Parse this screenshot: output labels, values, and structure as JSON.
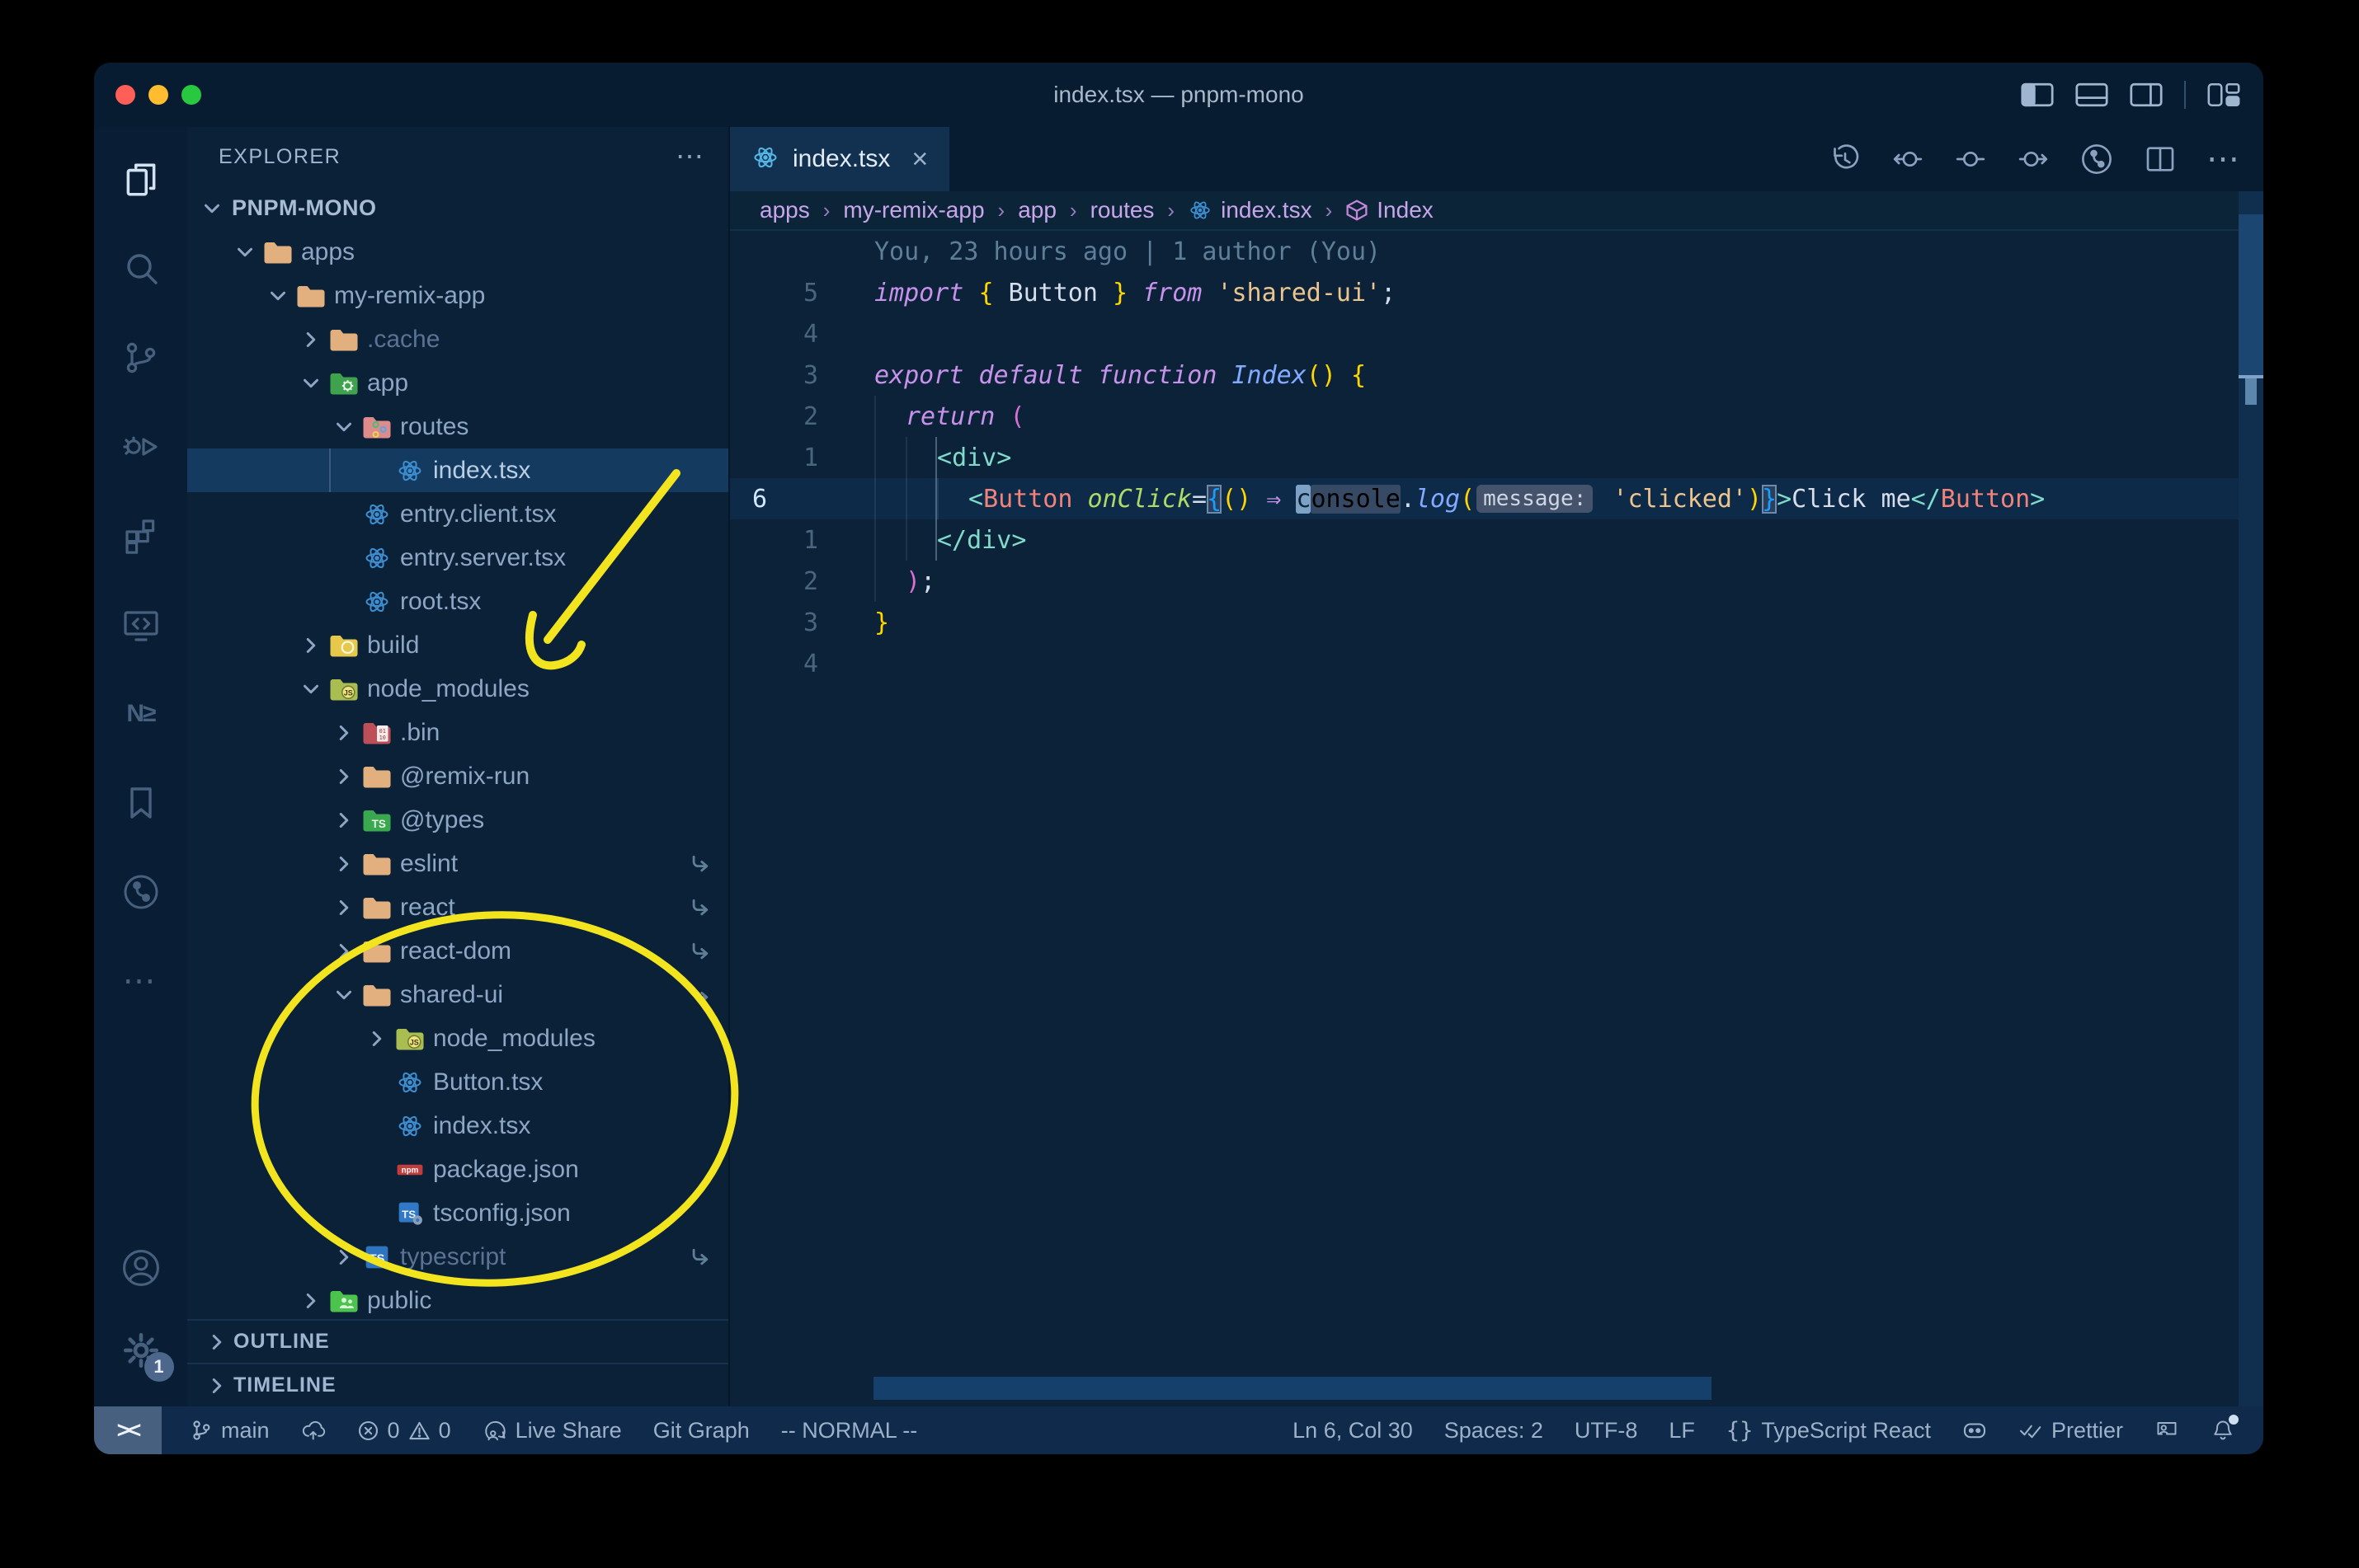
{
  "window": {
    "title": "index.tsx — pnpm-mono"
  },
  "titlebar": {
    "traffic_lights": [
      "close",
      "minimize",
      "zoom"
    ],
    "layout_icons": [
      "toggle-primary-sidebar",
      "toggle-panel",
      "toggle-secondary-sidebar",
      "customize-layout"
    ]
  },
  "activity_bar": {
    "top": [
      {
        "name": "explorer",
        "active": true
      },
      {
        "name": "search"
      },
      {
        "name": "source-control"
      },
      {
        "name": "run-and-debug"
      },
      {
        "name": "extensions"
      },
      {
        "name": "remote-explorer"
      },
      {
        "name": "nx-console",
        "text": "N≥"
      },
      {
        "name": "bookmarks"
      },
      {
        "name": "gitlens"
      },
      {
        "name": "additional-views"
      }
    ],
    "bottom": [
      {
        "name": "accounts"
      },
      {
        "name": "settings",
        "badge": "1"
      }
    ]
  },
  "sidebar": {
    "header": "EXPLORER",
    "header_menu": "⋯",
    "tree": [
      {
        "label": "PNPM-MONO",
        "level": 0,
        "chevron": "down",
        "bold": true
      },
      {
        "label": "apps",
        "level": 1,
        "chevron": "down",
        "icon": "folder-tan"
      },
      {
        "label": "my-remix-app",
        "level": 2,
        "chevron": "down",
        "icon": "folder-tan"
      },
      {
        "label": ".cache",
        "level": 3,
        "chevron": "right",
        "icon": "folder-tan",
        "dim": true
      },
      {
        "label": "app",
        "level": 3,
        "chevron": "down",
        "icon": "folder-app"
      },
      {
        "label": "routes",
        "level": 4,
        "chevron": "down",
        "icon": "folder-routes"
      },
      {
        "label": "index.tsx",
        "level": 5,
        "icon": "react",
        "selected": true,
        "guide": true
      },
      {
        "label": "entry.client.tsx",
        "level": 4,
        "icon": "react"
      },
      {
        "label": "entry.server.tsx",
        "level": 4,
        "icon": "react"
      },
      {
        "label": "root.tsx",
        "level": 4,
        "icon": "react"
      },
      {
        "label": "build",
        "level": 3,
        "chevron": "right",
        "icon": "folder-build"
      },
      {
        "label": "node_modules",
        "level": 3,
        "chevron": "down",
        "icon": "folder-js"
      },
      {
        "label": ".bin",
        "level": 4,
        "chevron": "right",
        "icon": "folder-bin"
      },
      {
        "label": "@remix-run",
        "level": 4,
        "chevron": "right",
        "icon": "folder-tan"
      },
      {
        "label": "@types",
        "level": 4,
        "chevron": "right",
        "icon": "folder-ts"
      },
      {
        "label": "eslint",
        "level": 4,
        "chevron": "right",
        "icon": "folder-tan",
        "symlink": true
      },
      {
        "label": "react",
        "level": 4,
        "chevron": "right",
        "icon": "folder-tan",
        "symlink": true
      },
      {
        "label": "react-dom",
        "level": 4,
        "chevron": "right",
        "icon": "folder-tan",
        "symlink": true
      },
      {
        "label": "shared-ui",
        "level": 4,
        "chevron": "down",
        "icon": "folder-tan",
        "symlink": true
      },
      {
        "label": "node_modules",
        "level": 5,
        "chevron": "right",
        "icon": "folder-js"
      },
      {
        "label": "Button.tsx",
        "level": 5,
        "icon": "react"
      },
      {
        "label": "index.tsx",
        "level": 5,
        "icon": "react"
      },
      {
        "label": "package.json",
        "level": 5,
        "icon": "npm"
      },
      {
        "label": "tsconfig.json",
        "level": 5,
        "icon": "ts-gear"
      },
      {
        "label": "typescript",
        "level": 4,
        "chevron": "right",
        "icon": "folder-typescript",
        "dim": true,
        "symlink": true
      },
      {
        "label": "public",
        "level": 3,
        "chevron": "right",
        "icon": "folder-public"
      }
    ],
    "panels": [
      {
        "label": "OUTLINE"
      },
      {
        "label": "TIMELINE"
      }
    ]
  },
  "editor": {
    "tab": {
      "label": "index.tsx",
      "icon": "react",
      "close": "×",
      "active": true
    },
    "toolbar": [
      "history",
      "previous-change",
      "changes",
      "next-change",
      "gitlens",
      "split-editor",
      "more-actions"
    ],
    "breadcrumbs": [
      {
        "label": "apps"
      },
      {
        "label": "my-remix-app"
      },
      {
        "label": "app"
      },
      {
        "label": "routes"
      },
      {
        "label": "index.tsx",
        "icon": "react"
      },
      {
        "label": "Index",
        "icon": "symbol-module"
      }
    ],
    "blame": "You, 23 hours ago | 1 author (You)",
    "lines": [
      {
        "type": "blame"
      },
      {
        "num": "5",
        "indent": 0,
        "tokens": [
          [
            "kw",
            "import"
          ],
          [
            "d",
            " "
          ],
          [
            "y",
            "{"
          ],
          [
            "d",
            " Button "
          ],
          [
            "y",
            "}"
          ],
          [
            "d",
            " "
          ],
          [
            "kw",
            "from"
          ],
          [
            "d",
            " "
          ],
          [
            "str",
            "'shared-ui'"
          ],
          [
            "d",
            ";"
          ]
        ]
      },
      {
        "num": "4",
        "indent": 0,
        "tokens": []
      },
      {
        "num": "3",
        "indent": 0,
        "tokens": [
          [
            "kw",
            "export"
          ],
          [
            "d",
            " "
          ],
          [
            "kw",
            "default"
          ],
          [
            "d",
            " "
          ],
          [
            "kw",
            "function"
          ],
          [
            "d",
            " "
          ],
          [
            "fn",
            "Index"
          ],
          [
            "y",
            "()"
          ],
          [
            "d",
            " "
          ],
          [
            "y",
            "{"
          ]
        ]
      },
      {
        "num": "2",
        "indent": 1,
        "tokens": [
          [
            "kw",
            "return"
          ],
          [
            "d",
            " "
          ],
          [
            "pk",
            "("
          ]
        ]
      },
      {
        "num": "1",
        "indent": 2,
        "tokens": [
          [
            "tag",
            "<"
          ],
          [
            "tag",
            "div"
          ],
          [
            "tag",
            ">"
          ]
        ]
      },
      {
        "num": "6",
        "indent": 3,
        "current": true,
        "tokens": [
          [
            "tag",
            "<"
          ],
          [
            "cmp",
            "Button"
          ],
          [
            "d",
            " "
          ],
          [
            "attr",
            "onClick"
          ],
          [
            "d",
            "="
          ],
          [
            "bl bm",
            "{"
          ],
          [
            "y",
            "()"
          ],
          [
            "d",
            " "
          ],
          [
            "arr",
            "⇒"
          ],
          [
            "d",
            " "
          ],
          [
            "cur",
            "c"
          ],
          [
            "hlw",
            "onsole"
          ],
          [
            "d",
            "."
          ],
          [
            "fn",
            "log"
          ],
          [
            "y",
            "("
          ],
          [
            "inlay",
            "message:"
          ],
          [
            "d",
            " "
          ],
          [
            "str",
            "'clicked'"
          ],
          [
            "y",
            ")"
          ],
          [
            "bl bm",
            "}"
          ],
          [
            "tag",
            ">"
          ],
          [
            "d",
            "Click me"
          ],
          [
            "tag",
            "</"
          ],
          [
            "cmp",
            "Button"
          ],
          [
            "tag",
            ">"
          ]
        ]
      },
      {
        "num": "1",
        "indent": 2,
        "tokens": [
          [
            "tag",
            "</"
          ],
          [
            "tag",
            "div"
          ],
          [
            "tag",
            ">"
          ]
        ]
      },
      {
        "num": "2",
        "indent": 1,
        "tokens": [
          [
            "pk",
            ")"
          ],
          [
            "d",
            ";"
          ]
        ]
      },
      {
        "num": "3",
        "indent": 0,
        "tokens": [
          [
            "y",
            "}"
          ]
        ]
      },
      {
        "num": "4",
        "indent": 0,
        "tokens": []
      }
    ]
  },
  "status_bar": {
    "left": [
      {
        "name": "remote",
        "label": "><"
      },
      {
        "name": "branch",
        "icon": "git-branch",
        "label": "main"
      },
      {
        "name": "sync",
        "icon": "cloud-upload",
        "label": ""
      },
      {
        "name": "problems",
        "errors": "0",
        "warnings": "0"
      },
      {
        "name": "live-share",
        "icon": "live-share",
        "label": "Live Share"
      },
      {
        "name": "git-graph",
        "label": "Git Graph"
      },
      {
        "name": "vim-mode",
        "label": "-- NORMAL --"
      }
    ],
    "right": [
      {
        "name": "cursor-position",
        "label": "Ln 6, Col 30"
      },
      {
        "name": "indentation",
        "label": "Spaces: 2"
      },
      {
        "name": "encoding",
        "label": "UTF-8"
      },
      {
        "name": "eol",
        "label": "LF"
      },
      {
        "name": "language-mode",
        "icon": "braces",
        "label": "TypeScript React"
      },
      {
        "name": "copilot",
        "icon": "copilot",
        "label": ""
      },
      {
        "name": "formatter",
        "icon": "double-check",
        "label": "Prettier"
      },
      {
        "name": "feedback",
        "icon": "feedback",
        "label": ""
      },
      {
        "name": "notifications",
        "icon": "bell",
        "label": ""
      }
    ]
  },
  "annotations": {
    "color": "#f2e41e",
    "shapes": [
      "arrow-to-node-modules",
      "ellipse-around-shared-ui"
    ]
  },
  "colors": {
    "traffic": [
      "#ff5f57",
      "#febc2e",
      "#28c840"
    ],
    "editor_bg": "#0b2239",
    "accent_selection": "#143a60"
  }
}
